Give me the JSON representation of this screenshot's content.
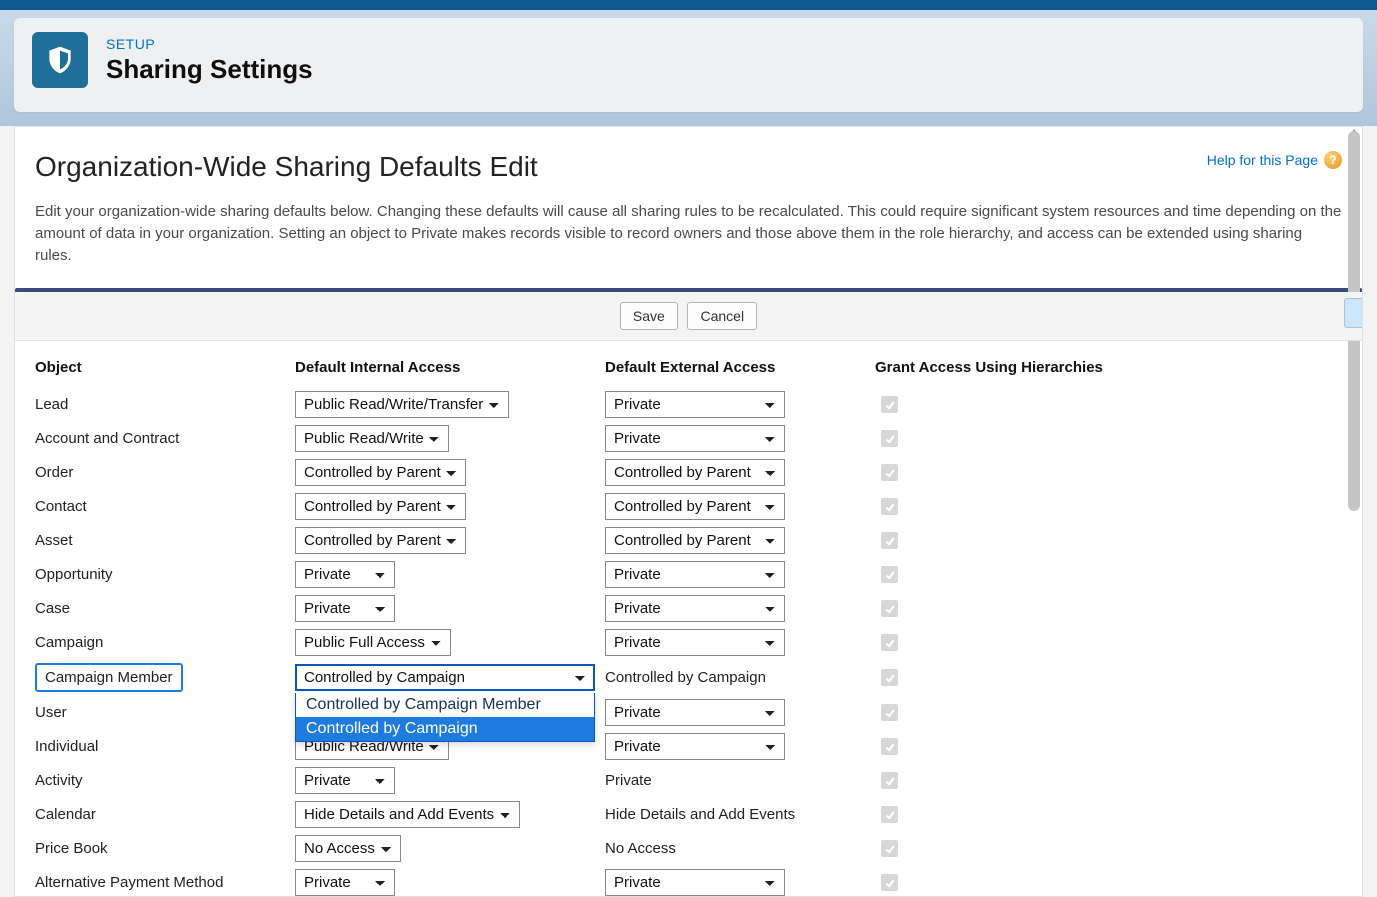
{
  "header": {
    "eyebrow": "SETUP",
    "title": "Sharing Settings"
  },
  "page": {
    "title": "Organization-Wide Sharing Defaults Edit",
    "help_label": "Help for this Page",
    "intro": "Edit your organization-wide sharing defaults below. Changing these defaults will cause all sharing rules to be recalculated. This could require significant system resources and time depending on the amount of data in your organization. Setting an object to Private makes records visible to record owners and those above them in the role hierarchy, and access can be extended using sharing rules."
  },
  "buttons": {
    "save": "Save",
    "cancel": "Cancel"
  },
  "columns": {
    "object": "Object",
    "internal": "Default Internal Access",
    "external": "Default External Access",
    "hierarchy": "Grant Access Using Hierarchies"
  },
  "dropdown": {
    "opt1": "Controlled by Campaign Member",
    "opt2": "Controlled by Campaign"
  },
  "rows": [
    {
      "obj": "Lead",
      "internal": "Public Read/Write/Transfer",
      "external": "Private",
      "ext_static": false
    },
    {
      "obj": "Account and Contract",
      "internal": "Public Read/Write",
      "external": "Private",
      "ext_static": false
    },
    {
      "obj": "Order",
      "internal": "Controlled by Parent",
      "external": "Controlled by Parent",
      "ext_static": false
    },
    {
      "obj": "Contact",
      "internal": "Controlled by Parent",
      "external": "Controlled by Parent",
      "ext_static": false
    },
    {
      "obj": "Asset",
      "internal": "Controlled by Parent",
      "external": "Controlled by Parent",
      "ext_static": false
    },
    {
      "obj": "Opportunity",
      "internal": "Private",
      "external": "Private",
      "ext_static": false
    },
    {
      "obj": "Case",
      "internal": "Private",
      "external": "Private",
      "ext_static": false
    },
    {
      "obj": "Campaign",
      "internal": "Public Full Access",
      "external": "Private",
      "ext_static": false
    },
    {
      "obj": "Campaign Member",
      "internal": "Controlled by Campaign",
      "external": "Controlled by Campaign",
      "ext_static": true,
      "highlight": true,
      "open": true
    },
    {
      "obj": "User",
      "internal": "",
      "external": "Private",
      "ext_static": false
    },
    {
      "obj": "Individual",
      "internal": "Public Read/Write",
      "external": "Private",
      "ext_static": false
    },
    {
      "obj": "Activity",
      "internal": "Private",
      "external": "Private",
      "ext_static": true
    },
    {
      "obj": "Calendar",
      "internal": "Hide Details and Add Events",
      "external": "Hide Details and Add Events",
      "ext_static": true
    },
    {
      "obj": "Price Book",
      "internal": "No Access",
      "external": "No Access",
      "ext_static": true
    },
    {
      "obj": "Alternative Payment Method",
      "internal": "Private",
      "external": "Private",
      "ext_static": false
    }
  ]
}
